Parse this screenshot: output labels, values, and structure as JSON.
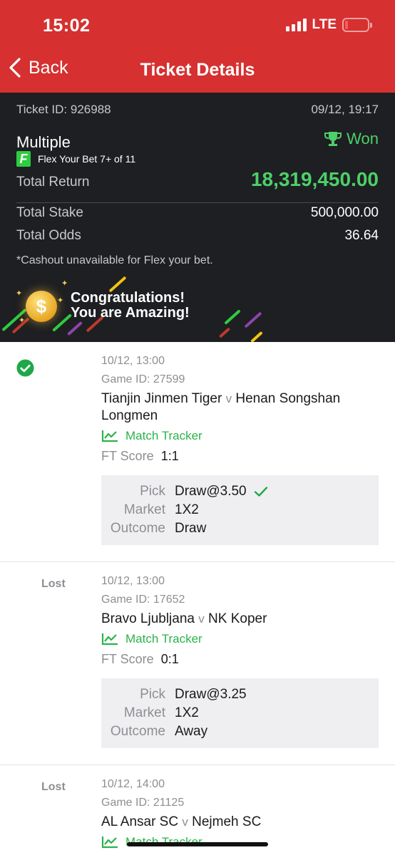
{
  "status_bar": {
    "time": "15:02",
    "network": "LTE"
  },
  "nav": {
    "back_label": "Back",
    "title": "Ticket Details"
  },
  "ticket": {
    "id_label": "Ticket ID: 926988",
    "datetime": "09/12, 19:17",
    "bet_type": "Multiple",
    "result": "Won",
    "flex_label": "Flex Your Bet 7+ of 11",
    "total_return_label": "Total Return",
    "total_return_value": "18,319,450.00",
    "total_stake_label": "Total Stake",
    "total_stake_value": "500,000.00",
    "total_odds_label": "Total Odds",
    "total_odds_value": "36.64",
    "cashout_note": "*Cashout unavailable for Flex your bet."
  },
  "congrats": {
    "line1": "Congratulations!",
    "line2": "You are Amazing!"
  },
  "selections": [
    {
      "status": "won",
      "status_label": "",
      "datetime": "10/12, 13:00",
      "game_id": "Game ID: 27599",
      "home": "Tianjin Jinmen Tiger",
      "vs": "v",
      "away": "Henan Songshan Longmen",
      "tracker_label": "Match Tracker",
      "score_label": "FT Score",
      "score": "1:1",
      "pick_label": "Pick",
      "pick": "Draw@3.50",
      "market_label": "Market",
      "market": "1X2",
      "outcome_label": "Outcome",
      "outcome": "Draw"
    },
    {
      "status": "lost",
      "status_label": "Lost",
      "datetime": "10/12, 13:00",
      "game_id": "Game ID: 17652",
      "home": "Bravo Ljubljana",
      "vs": "v",
      "away": "NK Koper",
      "tracker_label": "Match Tracker",
      "score_label": "FT Score",
      "score": "0:1",
      "pick_label": "Pick",
      "pick": "Draw@3.25",
      "market_label": "Market",
      "market": "1X2",
      "outcome_label": "Outcome",
      "outcome": "Away"
    },
    {
      "status": "lost",
      "status_label": "Lost",
      "datetime": "10/12, 14:00",
      "game_id": "Game ID: 21125",
      "home": "AL Ansar SC",
      "vs": "v",
      "away": "Nejmeh SC",
      "tracker_label": "Match Tracker"
    }
  ],
  "colors": {
    "brand_red": "#d63030",
    "win_green": "#4cd06a",
    "dark_bg": "#1e1f22",
    "tracker_green": "#2bb34a"
  }
}
